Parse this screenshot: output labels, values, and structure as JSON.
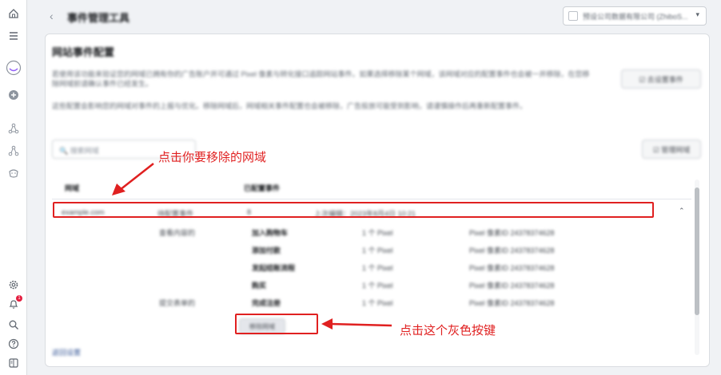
{
  "sidebar": {
    "icons": [
      "home-icon",
      "menu-icon",
      "avatar",
      "add-icon",
      "network-icon",
      "network-alt-icon",
      "smiley-icon",
      "settings-icon",
      "bell-icon",
      "search-icon",
      "help-icon",
      "panel-icon"
    ],
    "notification_count": "1"
  },
  "topbar": {
    "back_glyph": "‹",
    "title": "事件管理工具",
    "account": "预设公司数据有限公司 (ZhiboS...",
    "caret": "▾"
  },
  "card": {
    "title": "网站事件配置",
    "desc1": "若使用该功能来验证您的网域已拥有你的广告账户并可通过 Pixel 像素与转化接口追踪网站事件。如果选择移除某个网域，该网域对应的配置事件也会被一并移除，在您移除网域前请确认事件已经发生。",
    "desc2": "这些配置会影响您的网域对事件的上报与优化。移除网域后，网域相关事件配置也会被移除，广告投放可能受到影响，请谨慎操作后再重新配置事件。",
    "config_button": "☑ 去设置事件",
    "search_placeholder": "🔍 搜索网域",
    "sync_button": "☑ 管理网域"
  },
  "table": {
    "headers": [
      "网域",
      "已配置事件"
    ],
    "domain_row": {
      "domain": "example.com",
      "status": "待配置事件",
      "count": "8",
      "meta": "上次编辑：2023年8月4日 10:21"
    },
    "events": [
      {
        "group": "查看内容的",
        "name": "加入购物车",
        "source": "1 个 Pixel",
        "pixel": "Pixel 像素ID 24378374628"
      },
      {
        "group": "",
        "name": "添加付款",
        "source": "1 个 Pixel",
        "pixel": "Pixel 像素ID 24378374628"
      },
      {
        "group": "",
        "name": "发起结账流程",
        "source": "1 个 Pixel",
        "pixel": "Pixel 像素ID 24378374628"
      },
      {
        "group": "",
        "name": "购买",
        "source": "1 个 Pixel",
        "pixel": "Pixel 像素ID 24378374628"
      },
      {
        "group": "提交表单的",
        "name": "完成注册",
        "source": "1 个 Pixel",
        "pixel": "Pixel 像素ID 24378374628"
      }
    ],
    "gray_button": "移除网域",
    "footer_link": "返回设置"
  },
  "annotations": {
    "top_callout": "点击你要移除的网域",
    "bottom_callout": "点击这个灰色按键",
    "color": "#e02020"
  }
}
